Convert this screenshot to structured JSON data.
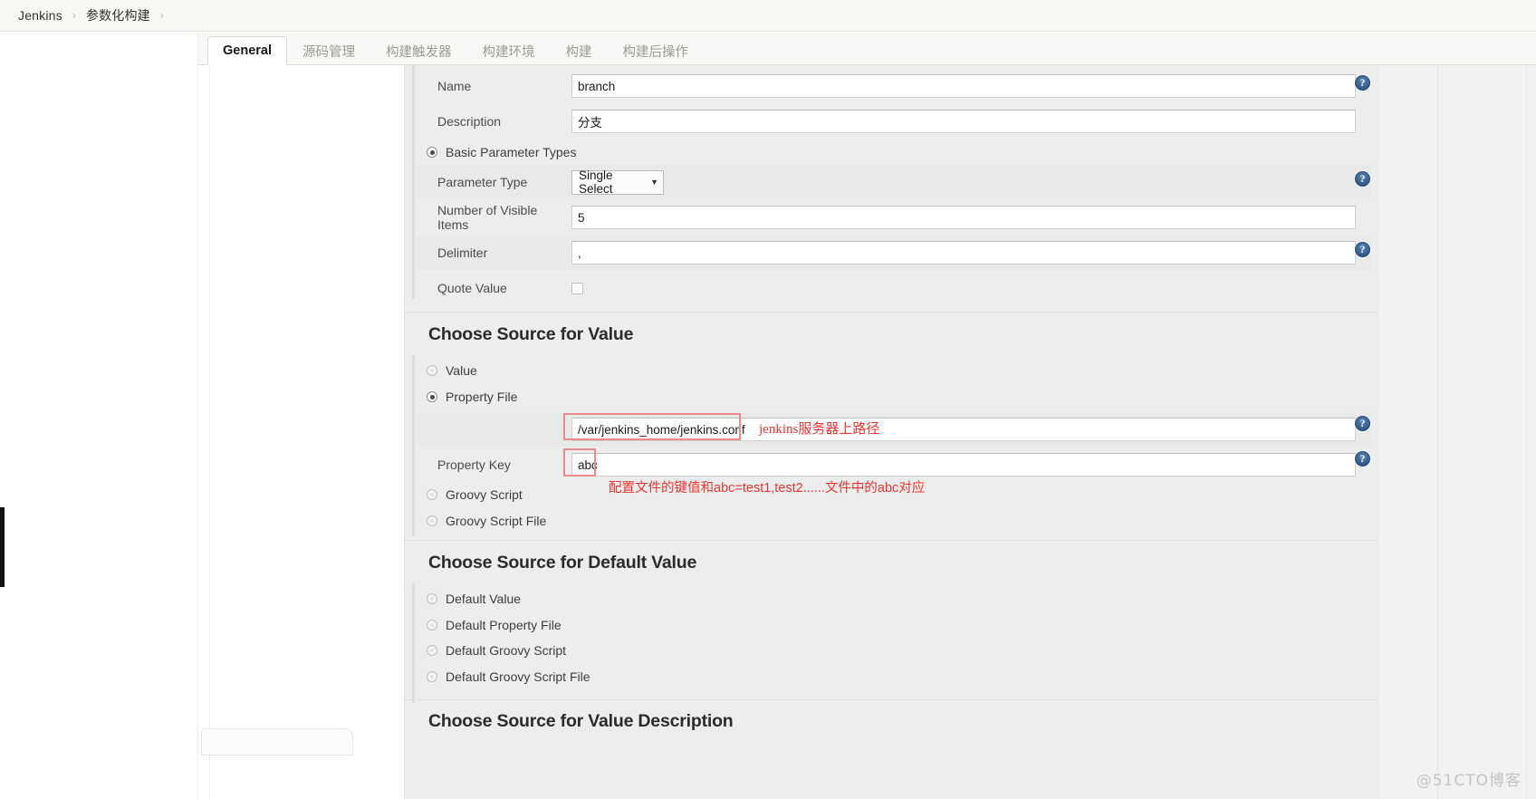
{
  "breadcrumb": {
    "items": [
      "Jenkins",
      "参数化构建"
    ],
    "separator": "›"
  },
  "tabs": [
    {
      "label": "General",
      "active": true
    },
    {
      "label": "源码管理",
      "active": false
    },
    {
      "label": "构建触发器",
      "active": false
    },
    {
      "label": "构建环境",
      "active": false
    },
    {
      "label": "构建",
      "active": false
    },
    {
      "label": "构建后操作",
      "active": false
    }
  ],
  "parameter_form": {
    "name": {
      "label": "Name",
      "value": "branch"
    },
    "description": {
      "label": "Description",
      "value": "分支"
    },
    "basic_parameter_types": {
      "label": "Basic Parameter Types",
      "selected": true
    },
    "parameter_type": {
      "label": "Parameter Type",
      "value": "Single Select",
      "caret": "▼"
    },
    "number_of_visible_items": {
      "label": "Number of Visible Items",
      "value": "5"
    },
    "delimiter": {
      "label": "Delimiter",
      "value": ","
    },
    "quote_value": {
      "label": "Quote Value",
      "checked": false
    }
  },
  "choose_source_value": {
    "title": "Choose Source for Value",
    "options": [
      {
        "label": "Value",
        "selected": false
      },
      {
        "label": "Property File",
        "selected": true
      },
      {
        "label": "Groovy Script",
        "selected": false
      },
      {
        "label": "Groovy Script File",
        "selected": false
      }
    ],
    "property_file_path": {
      "value": "/var/jenkins_home/jenkins.conf"
    },
    "property_key": {
      "label": "Property Key",
      "value": "abc"
    }
  },
  "choose_source_default_value": {
    "title": "Choose Source for Default Value",
    "options": [
      {
        "label": "Default Value",
        "selected": false
      },
      {
        "label": "Default Property File",
        "selected": false
      },
      {
        "label": "Default Groovy Script",
        "selected": false
      },
      {
        "label": "Default Groovy Script File",
        "selected": false
      }
    ]
  },
  "choose_source_value_description": {
    "title": "Choose Source for Value Description"
  },
  "annotations": [
    {
      "id": "path-note",
      "text": "jenkins服务器上路径"
    },
    {
      "id": "key-note",
      "text": "配置文件的键值和abc=test1,test2......文件中的abc对应"
    }
  ],
  "help_icon_glyph": "?",
  "watermark": "@51CTO博客",
  "colors": {
    "annotation_red": "#f2332e",
    "annotation_box": "#ec8b8b",
    "panel_bg": "#eceded",
    "help_blue": "#3f6897"
  }
}
